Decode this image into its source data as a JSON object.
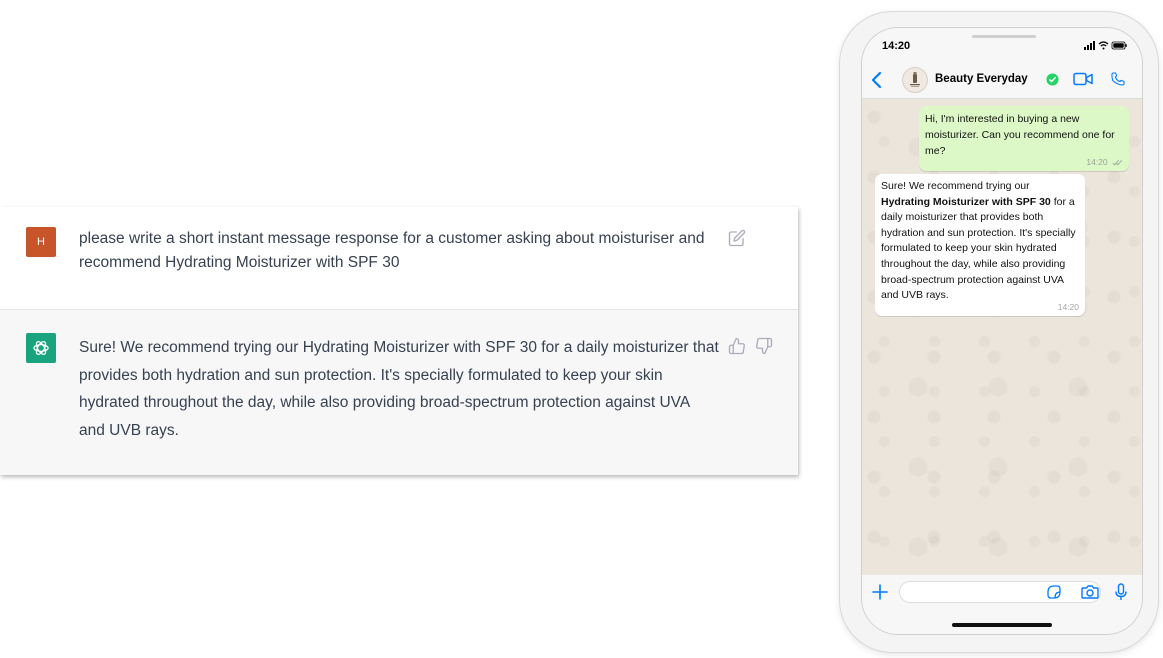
{
  "chatgpt": {
    "user_avatar": "H",
    "user_message": "please write a short instant message response for a customer asking about moisturiser and recommend Hydrating Moisturizer with SPF 30",
    "assistant_message": "Sure! We recommend trying our Hydrating Moisturizer with SPF 30 for a daily moisturizer that provides both hydration and sun protection. It's specially formulated to keep your skin hydrated throughout the day, while also providing broad-spectrum protection against UVA and UVB rays.",
    "icons": [
      "edit-icon",
      "thumbs-up-icon",
      "thumbs-down-icon",
      "openai-logo-icon"
    ],
    "colors": {
      "user_avatar_bg": "#c8552a",
      "assistant_avatar_bg": "#19a37f"
    }
  },
  "phone": {
    "status_time": "14:20",
    "contact_name": "Beauty Everyday",
    "outgoing": {
      "text": "Hi, I'm interested in buying a new moisturizer. Can you recommend one for me?",
      "time": "14:20"
    },
    "incoming": {
      "text_before": "Sure! We recommend trying our ",
      "bold": "Hydrating Moisturizer with SPF 30",
      "text_after": " for a daily moisturizer that provides both hydration and sun protection. It's specially formulated to keep your skin hydrated throughout the day, while also providing broad-spectrum protection against UVA and UVB rays.",
      "time": "14:20"
    },
    "input_placeholder": "",
    "icons": [
      "back-icon",
      "verified-icon",
      "video-call-icon",
      "phone-call-icon",
      "plus-icon",
      "sticker-icon",
      "camera-icon",
      "microphone-icon"
    ],
    "colors": {
      "accent": "#007aff",
      "outgoing_bubble": "#dcf8c6",
      "verified": "#25d366"
    }
  }
}
